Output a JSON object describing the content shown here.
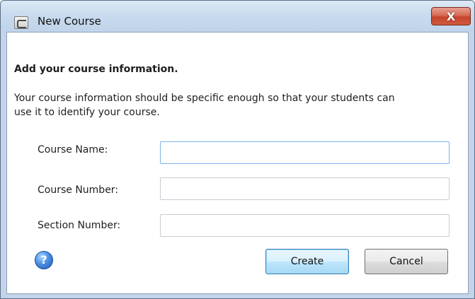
{
  "window": {
    "title": "New Course",
    "close_glyph": "X",
    "app_icon": "app-icon"
  },
  "form": {
    "heading": "Add your course information.",
    "description": "Your course information should be specific enough so that your students can use it to identify your course.",
    "fields": [
      {
        "label": "Course Name:",
        "value": "",
        "placeholder": ""
      },
      {
        "label": "Course Number:",
        "value": "",
        "placeholder": ""
      },
      {
        "label": "Section Number:",
        "value": "",
        "placeholder": ""
      }
    ]
  },
  "buttons": {
    "create_label": "Create",
    "cancel_label": "Cancel",
    "help_glyph": "?"
  },
  "colors": {
    "titlebar": "#c9dbee",
    "close_button": "#c5442c",
    "default_button_border": "#3c7fb1",
    "help_icon": "#4c8fe0"
  }
}
